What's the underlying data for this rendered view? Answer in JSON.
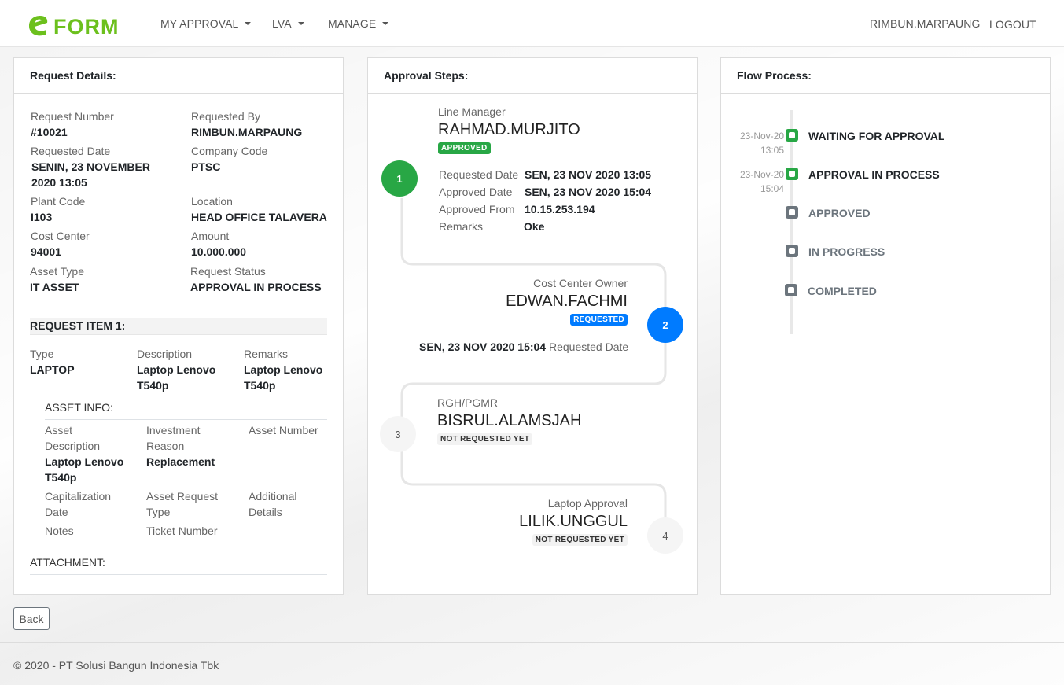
{
  "brand": {
    "logo_text": "FORM",
    "logo_color": "#6cc01d"
  },
  "nav": {
    "items": [
      {
        "label": "MY APPROVAL"
      },
      {
        "label": "LVA"
      },
      {
        "label": "MANAGE"
      }
    ],
    "user": "RIMBUN.MARPAUNG",
    "logout": "LOGOUT"
  },
  "request_details": {
    "title": "Request Details:",
    "request_number_label": "Request Number",
    "request_number": "#10021",
    "requested_by_label": "Requested By",
    "requested_by": "RIMBUN.MARPAUNG",
    "requested_date_label": "Requested Date",
    "requested_date_line1": "SENIN, 23 NOVEMBER",
    "requested_date_line2": "2020 13:05",
    "company_code_label": "Company Code",
    "company_code": "PTSC",
    "plant_code_label": "Plant Code",
    "plant_code": "I103",
    "location_label": "Location",
    "location": "HEAD OFFICE TALAVERA",
    "cost_center_label": "Cost Center",
    "cost_center": "94001",
    "amount_label": "Amount",
    "amount": "10.000.000",
    "asset_type_label": "Asset Type",
    "asset_type": "IT ASSET",
    "request_status_label": "Request Status",
    "request_status": "APPROVAL IN PROCESS",
    "item_heading": "REQUEST ITEM 1:",
    "type_label": "Type",
    "type": "LAPTOP",
    "description_label": "Description",
    "description_line1": "Laptop Lenovo",
    "description_line2": "T540p",
    "remarks_label": "Remarks",
    "remarks_line1": "Laptop Lenovo",
    "remarks_line2": "T540p",
    "asset_info_label": "ASSET INFO:",
    "asset_desc_label_line1": "Asset",
    "asset_desc_label_line2": "Description",
    "asset_desc_line1": "Laptop Lenovo",
    "asset_desc_line2": "T540p",
    "investment_reason_label_line1": "Investment",
    "investment_reason_label_line2": "Reason",
    "investment_reason": "Replacement",
    "asset_number_label": "Asset Number",
    "capitalization_label_line1": "Capitalization",
    "capitalization_label_line2": "Date",
    "asset_request_type_label_line1": "Asset Request",
    "asset_request_type_label_line2": "Type",
    "additional_details_label_line1": "Additional",
    "additional_details_label_line2": "Details",
    "notes_label": "Notes",
    "ticket_number_label": "Ticket Number",
    "attachment_label": "ATTACHMENT:"
  },
  "approval_steps": {
    "title": "Approval Steps:",
    "steps": [
      {
        "number": "1",
        "role": "Line Manager",
        "name": "RAHMAD.MURJITO",
        "status": "APPROVED",
        "requested_date_label": "Requested Date",
        "requested_date": "SEN, 23 NOV 2020 13:05",
        "approved_date_label": "Approved Date",
        "approved_date": "SEN, 23 NOV 2020 15:04",
        "approved_from_label": "Approved From",
        "approved_from": "10.15.253.194",
        "remarks_label": "Remarks",
        "remarks": "Oke"
      },
      {
        "number": "2",
        "role": "Cost Center Owner",
        "name": "EDWAN.FACHMI",
        "status": "REQUESTED",
        "requested_date": "SEN, 23 NOV 2020 15:04",
        "requested_date_label": "Requested Date"
      },
      {
        "number": "3",
        "role": "RGH/PGMR",
        "name": "BISRUL.ALAMSJAH",
        "status": "NOT REQUESTED YET"
      },
      {
        "number": "4",
        "role": "Laptop Approval",
        "name": "LILIK.UNGGUL",
        "status": "NOT REQUESTED YET"
      }
    ]
  },
  "flow_process": {
    "title": "Flow Process:",
    "items": [
      {
        "date": "23-Nov-20",
        "time": "13:05",
        "label": "WAITING FOR APPROVAL",
        "state": "done"
      },
      {
        "date": "23-Nov-20",
        "time": "15:04",
        "label": "APPROVAL IN PROCESS",
        "state": "done"
      },
      {
        "date": "",
        "time": "",
        "label": "APPROVED",
        "state": "pending"
      },
      {
        "date": "",
        "time": "",
        "label": "IN PROGRESS",
        "state": "pending"
      },
      {
        "date": "",
        "time": "",
        "label": "COMPLETED",
        "state": "pending"
      }
    ],
    "colors": {
      "done": "#28a745",
      "pending": "#6c757d"
    }
  },
  "back_button": "Back",
  "footer": "© 2020 - PT Solusi Bangun Indonesia Tbk",
  "colors": {
    "green": "#28a745",
    "blue": "#007bff"
  }
}
